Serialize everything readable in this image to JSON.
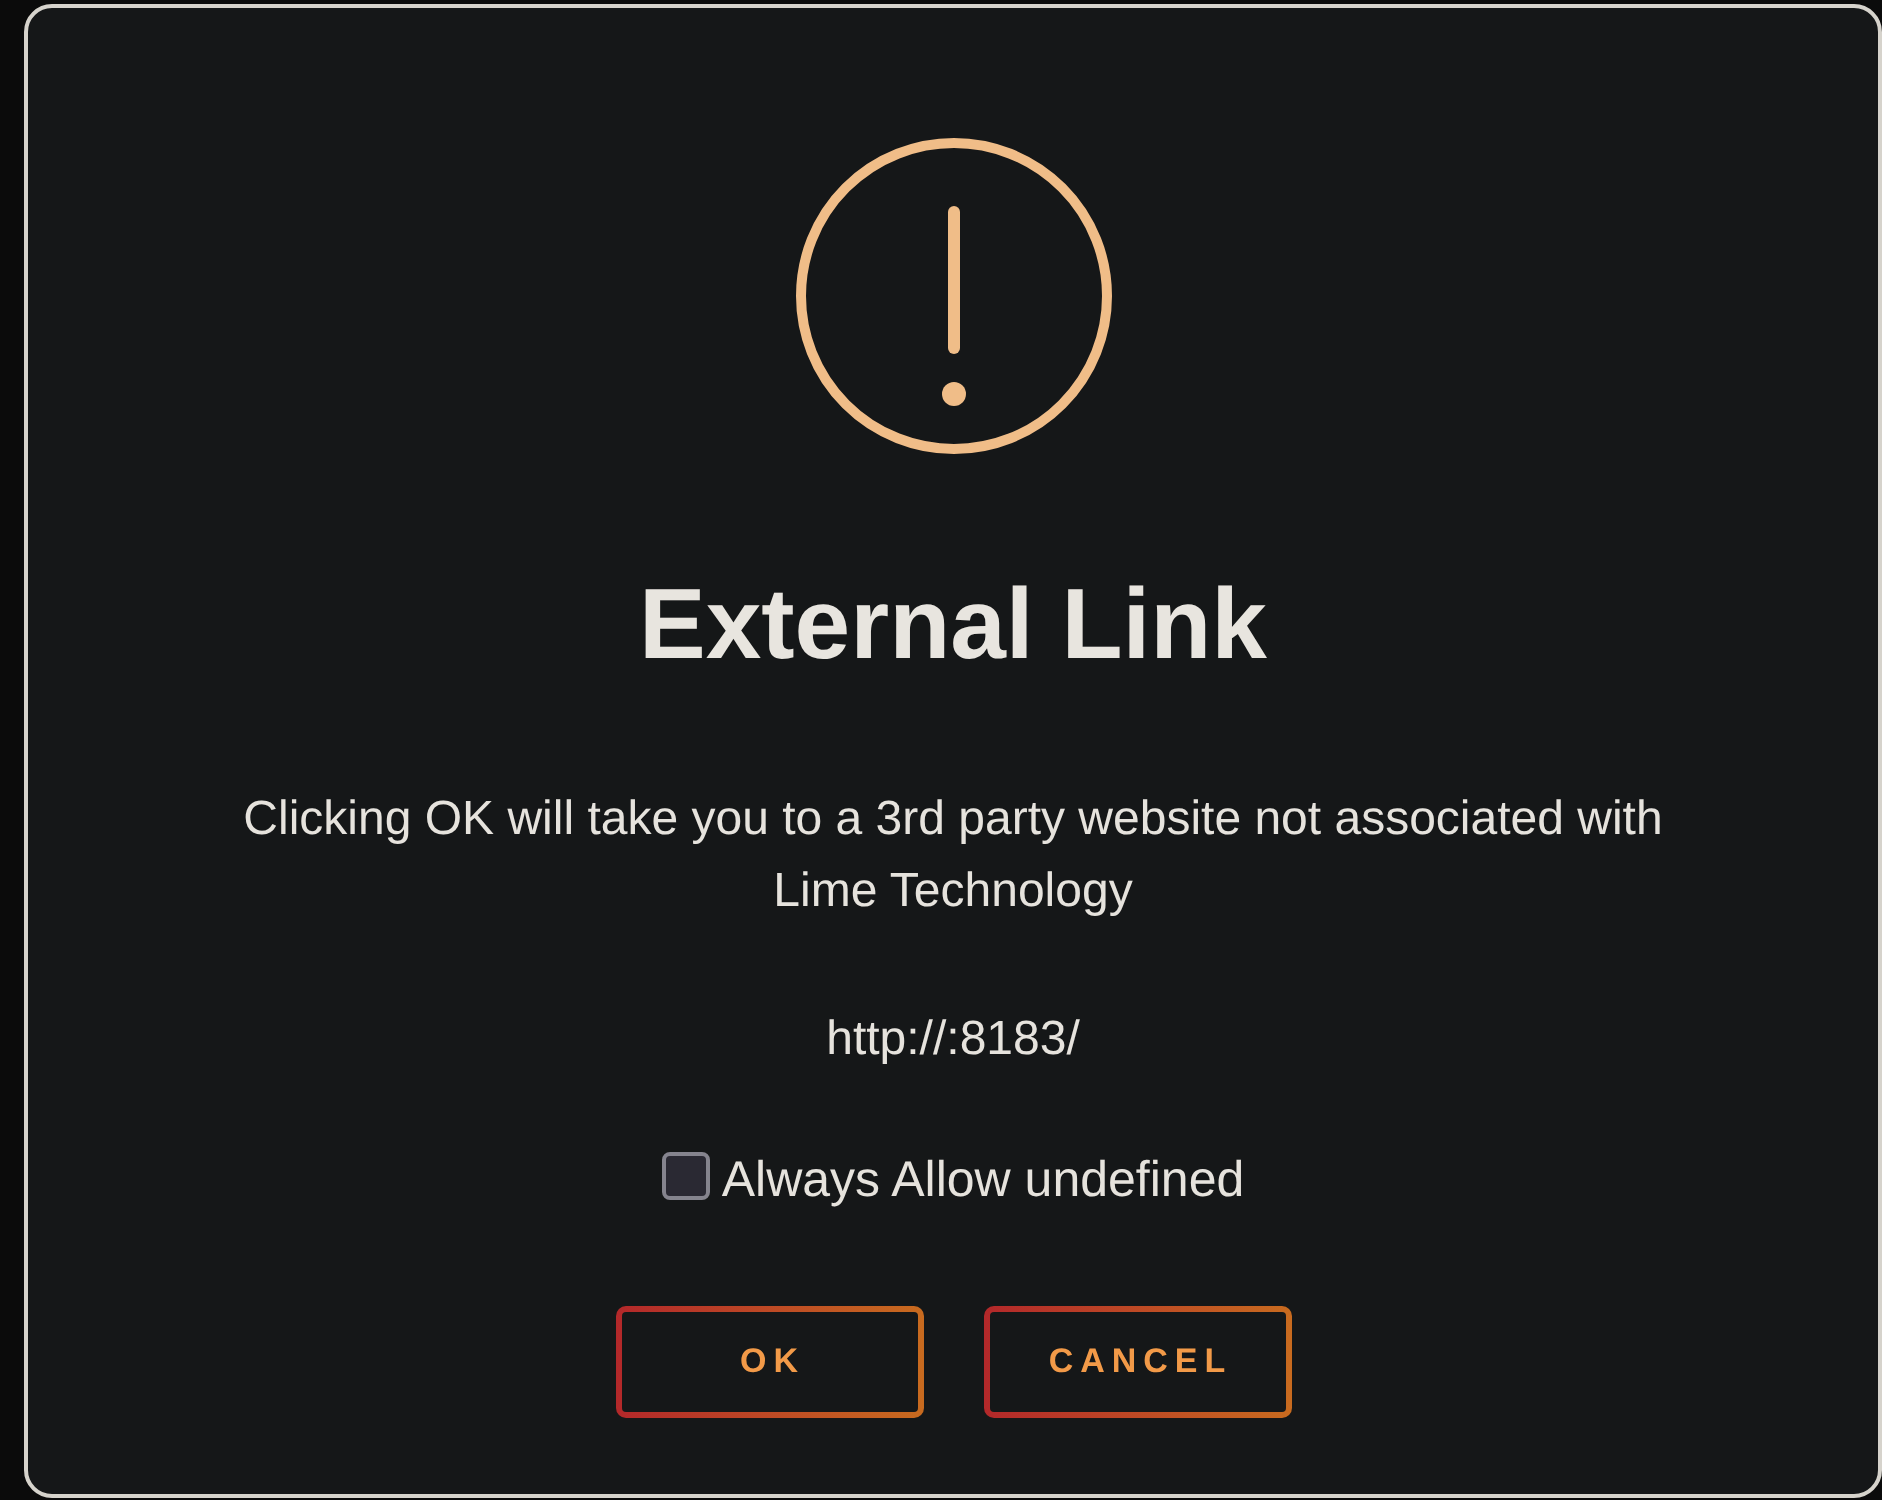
{
  "dialog": {
    "title": "External Link",
    "message": "Clicking OK will take you to a 3rd party website not associated with Lime Technology",
    "url": "http://:8183/",
    "checkbox": {
      "label": "Always Allow undefined",
      "checked": false
    },
    "buttons": [
      {
        "label": "OK"
      },
      {
        "label": "CANCEL"
      }
    ]
  }
}
